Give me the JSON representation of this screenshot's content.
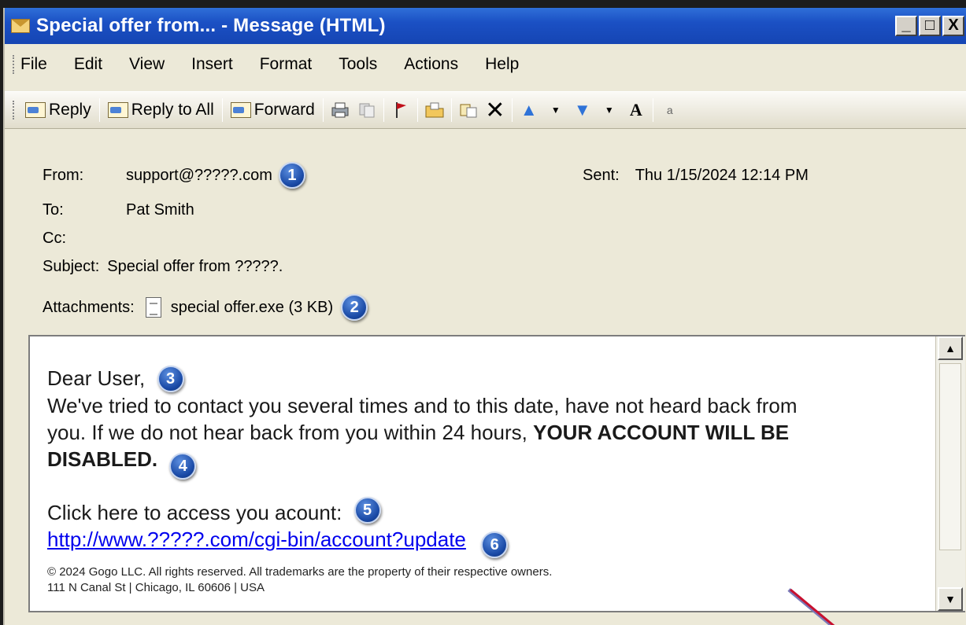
{
  "window": {
    "title": "Special offer from... - Message (HTML)",
    "controls": [
      "_",
      "□",
      "X"
    ]
  },
  "menu": [
    "File",
    "Edit",
    "View",
    "Insert",
    "Format",
    "Tools",
    "Actions",
    "Help"
  ],
  "toolbar": {
    "reply": "Reply",
    "reply_all": "Reply to All",
    "forward": "Forward"
  },
  "header": {
    "from_label": "From:",
    "from_value": "support@?????.com",
    "to_label": "To:",
    "to_value": "Pat Smith",
    "cc_label": "Cc:",
    "cc_value": "",
    "subject_label": "Subject:",
    "subject_value": "Special offer from ?????.",
    "sent_label": "Sent:",
    "sent_value": "Thu 1/15/2024 12:14 PM",
    "attachments_label": "Attachments:",
    "attachment_value": "special offer.exe (3 KB)"
  },
  "badges": [
    "1",
    "2",
    "3",
    "4",
    "5",
    "6"
  ],
  "message": {
    "greeting": "Dear User,",
    "line1": "We've tried to contact you several times and to this date, have not heard back from",
    "line2": "you. If we do not hear back from you within 24 hours, ",
    "warning_part1": "YOUR ACCOUNT WILL BE",
    "warning_part2": "DISABLED.",
    "cta": "Click here to access you acount:",
    "link": "http://www.?????.com/cgi-bin/account?update",
    "footer1": "© 2024 Gogo LLC. All rights reserved. All trademarks are the property of their respective owners.",
    "footer2": "111 N Canal St | Chicago, IL 60606 | USA"
  },
  "colors": {
    "titlebar": "#1b50c4",
    "badge": "#1a4aa6",
    "link": "#0000ee",
    "cursor": "#c8102e"
  }
}
